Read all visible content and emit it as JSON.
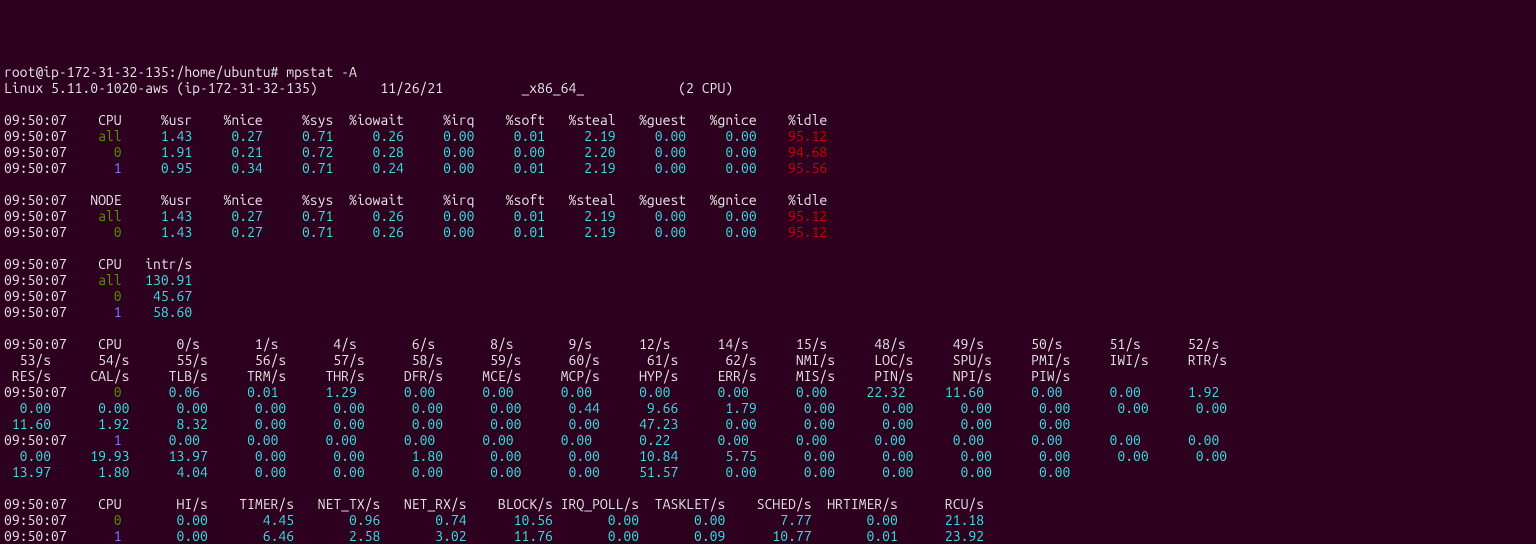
{
  "prompt": "root@ip-172-31-32-135:/home/ubuntu# ",
  "cmd": "mpstat -A",
  "sysinfo": {
    "os": "Linux 5.11.0-1020-aws (ip-172-31-32-135)",
    "date": "11/26/21",
    "arch": "_x86_64_",
    "cpus": "(2 CPU)"
  },
  "cpu_usage": {
    "headers": [
      "%usr",
      "%nice",
      "%sys",
      "%iowait",
      "%irq",
      "%soft",
      "%steal",
      "%guest",
      "%gnice",
      "%idle"
    ],
    "rows": [
      {
        "time": "09:50:07",
        "label": "all",
        "label_color": "green",
        "vals": [
          "1.43",
          "0.27",
          "0.71",
          "0.26",
          "0.00",
          "0.01",
          "2.19",
          "0.00",
          "0.00",
          "95.12"
        ]
      },
      {
        "time": "09:50:07",
        "label": "0",
        "label_color": "green",
        "vals": [
          "1.91",
          "0.21",
          "0.72",
          "0.28",
          "0.00",
          "0.00",
          "2.20",
          "0.00",
          "0.00",
          "94.68"
        ]
      },
      {
        "time": "09:50:07",
        "label": "1",
        "label_color": "blue",
        "vals": [
          "0.95",
          "0.34",
          "0.71",
          "0.24",
          "0.00",
          "0.01",
          "2.19",
          "0.00",
          "0.00",
          "95.56"
        ]
      }
    ]
  },
  "node_usage": {
    "headers": [
      "%usr",
      "%nice",
      "%sys",
      "%iowait",
      "%irq",
      "%soft",
      "%steal",
      "%guest",
      "%gnice",
      "%idle"
    ],
    "rows": [
      {
        "time": "09:50:07",
        "label": "all",
        "label_color": "green",
        "vals": [
          "1.43",
          "0.27",
          "0.71",
          "0.26",
          "0.00",
          "0.01",
          "2.19",
          "0.00",
          "0.00",
          "95.12"
        ]
      },
      {
        "time": "09:50:07",
        "label": "0",
        "label_color": "green",
        "vals": [
          "1.43",
          "0.27",
          "0.71",
          "0.26",
          "0.00",
          "0.01",
          "2.19",
          "0.00",
          "0.00",
          "95.12"
        ]
      }
    ]
  },
  "intr": {
    "rows": [
      {
        "time": "09:50:07",
        "label": "all",
        "label_color": "green",
        "val": "130.91"
      },
      {
        "time": "09:50:07",
        "label": "0",
        "label_color": "green",
        "val": "45.67"
      },
      {
        "time": "09:50:07",
        "label": "1",
        "label_color": "blue",
        "val": "58.60"
      }
    ]
  },
  "intr_detail": {
    "header_line1": [
      "0/s",
      "1/s",
      "4/s",
      "6/s",
      "8/s",
      "9/s",
      "12/s",
      "14/s",
      "15/s",
      "48/s",
      "49/s",
      "50/s",
      "51/s",
      "52/s"
    ],
    "header_line2_left": "  53/s",
    "header_line2": [
      "54/s",
      "55/s",
      "56/s",
      "57/s",
      "58/s",
      "59/s",
      "60/s",
      "61/s",
      "62/s",
      "NMI/s",
      "LOC/s",
      "SPU/s",
      "PMI/s",
      "IWI/s",
      "RTR/s"
    ],
    "header_line3_left": " RES/s",
    "header_line3": [
      "CAL/s",
      "TLB/s",
      "TRM/s",
      "THR/s",
      "DFR/s",
      "MCE/s",
      "MCP/s",
      "HYP/s",
      "ERR/s",
      "MIS/s",
      "PIN/s",
      "NPI/s",
      "PIW/s"
    ],
    "cpu0": {
      "time": "09:50:07",
      "label": "0",
      "label_color": "green",
      "line1": [
        "0.06",
        "0.01",
        "1.29",
        "0.00",
        "0.00",
        "0.00",
        "0.00",
        "0.00",
        "0.00",
        "22.32",
        "11.60",
        "0.00",
        "0.00",
        "1.92"
      ],
      "line2_left": "  0.00",
      "line2": [
        "0.00",
        "0.00",
        "0.00",
        "0.00",
        "0.00",
        "0.00",
        "0.44",
        "9.66",
        "1.79",
        "0.00",
        "0.00",
        "0.00",
        "0.00",
        "0.00",
        "0.00"
      ],
      "line3_left": " 11.60",
      "line3": [
        "1.92",
        "8.32",
        "0.00",
        "0.00",
        "0.00",
        "0.00",
        "0.00",
        "47.23",
        "0.00",
        "0.00",
        "0.00",
        "0.00",
        "0.00"
      ]
    },
    "cpu1": {
      "time": "09:50:07",
      "label": "1",
      "label_color": "blue",
      "line1": [
        "0.00",
        "0.00",
        "0.00",
        "0.00",
        "0.00",
        "0.00",
        "0.22",
        "0.00",
        "0.00",
        "0.00",
        "0.00",
        "0.00",
        "0.00",
        "0.00"
      ],
      "line2_left": "  0.00",
      "line2": [
        "19.93",
        "13.97",
        "0.00",
        "0.00",
        "1.80",
        "0.00",
        "0.00",
        "10.84",
        "5.75",
        "0.00",
        "0.00",
        "0.00",
        "0.00",
        "0.00",
        "0.00"
      ],
      "line3_left": " 13.97",
      "line3": [
        "1.80",
        "4.04",
        "0.00",
        "0.00",
        "0.00",
        "0.00",
        "0.00",
        "51.57",
        "0.00",
        "0.00",
        "0.00",
        "0.00",
        "0.00"
      ]
    }
  },
  "softirq": {
    "headers": [
      "HI/s",
      "TIMER/s",
      "NET_TX/s",
      "NET_RX/s",
      "BLOCK/s",
      "IRQ_POLL/s",
      "TASKLET/s",
      "SCHED/s",
      "HRTIMER/s",
      "RCU/s"
    ],
    "rows": [
      {
        "time": "09:50:07",
        "label": "0",
        "label_color": "green",
        "vals": [
          "0.00",
          "4.45",
          "0.96",
          "0.74",
          "10.56",
          "0.00",
          "0.00",
          "7.77",
          "0.00",
          "21.18"
        ]
      },
      {
        "time": "09:50:07",
        "label": "1",
        "label_color": "blue",
        "vals": [
          "0.00",
          "6.46",
          "2.58",
          "3.02",
          "11.76",
          "0.00",
          "0.09",
          "10.77",
          "0.01",
          "23.92"
        ]
      }
    ]
  },
  "col_widths": {
    "time": 8,
    "label": 7,
    "val": 9,
    "arch_pad": 11,
    "intr_val": 9,
    "intr_det": 10,
    "soft": 11
  },
  "labels": {
    "cpu": "CPU",
    "node": "NODE",
    "intr": "intr/s"
  }
}
